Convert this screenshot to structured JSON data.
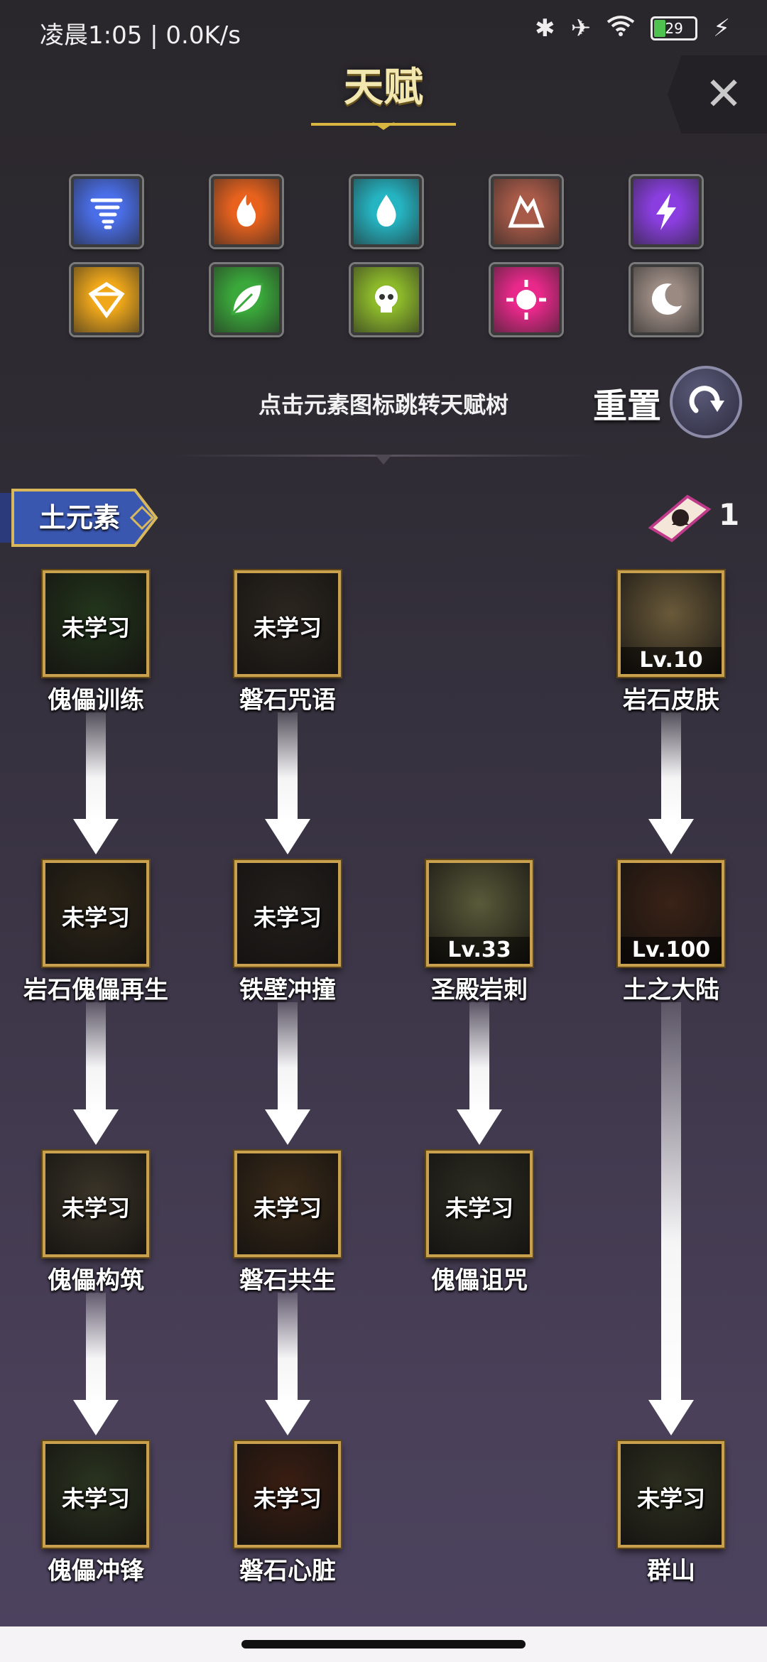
{
  "status_bar": {
    "time": "凌晨1:05 | 0.0K/s",
    "battery": "29"
  },
  "header": {
    "title": "天赋",
    "close_icon": "close-icon"
  },
  "elements": [
    {
      "name": "wind",
      "color": "#4a6ee8",
      "icon": "tornado-icon"
    },
    {
      "name": "fire",
      "color": "#e8621e",
      "icon": "flame-icon"
    },
    {
      "name": "water",
      "color": "#25b4c2",
      "icon": "drop-icon"
    },
    {
      "name": "earth",
      "color": "#a85a48",
      "icon": "rock-icon"
    },
    {
      "name": "lightning",
      "color": "#8a3ee0",
      "icon": "lightning-icon"
    },
    {
      "name": "light",
      "color": "#f0a81a",
      "icon": "gem-icon"
    },
    {
      "name": "nature",
      "color": "#3aa83a",
      "icon": "leaf-icon"
    },
    {
      "name": "poison",
      "color": "#8cb82a",
      "icon": "skull-icon"
    },
    {
      "name": "holy",
      "color": "#e8288a",
      "icon": "sun-icon"
    },
    {
      "name": "dark",
      "color": "#9a8a82",
      "icon": "moon-icon"
    }
  ],
  "hint": "点击元素图标跳转天赋树",
  "reset": {
    "label": "重置"
  },
  "section": {
    "title": "土元素",
    "points": "1"
  },
  "talents": [
    {
      "id": "golem-training",
      "name": "傀儡训练",
      "state": "未学习",
      "level": "",
      "col": 0,
      "row": 0,
      "bg": "#23361c"
    },
    {
      "id": "boulder-curse",
      "name": "磐石咒语",
      "state": "未学习",
      "level": "",
      "col": 1,
      "row": 0,
      "bg": "#2c2620"
    },
    {
      "id": "rock-skin",
      "name": "岩石皮肤",
      "state": "",
      "level": "Lv.10",
      "col": 3,
      "row": 0,
      "bg": "#6a5a3a"
    },
    {
      "id": "rock-golem-regen",
      "name": "岩石傀儡再生",
      "state": "未学习",
      "level": "",
      "col": 0,
      "row": 1,
      "bg": "#2e2618"
    },
    {
      "id": "iron-wall-charge",
      "name": "铁壁冲撞",
      "state": "未学习",
      "level": "",
      "col": 1,
      "row": 1,
      "bg": "#221f1c"
    },
    {
      "id": "shrine-rock-spike",
      "name": "圣殿岩刺",
      "state": "",
      "level": "Lv.33",
      "col": 2,
      "row": 1,
      "bg": "#5a5a3a"
    },
    {
      "id": "earth-continent",
      "name": "土之大陆",
      "state": "",
      "level": "Lv.100",
      "col": 3,
      "row": 1,
      "bg": "#3a2216"
    },
    {
      "id": "golem-construct",
      "name": "傀儡构筑",
      "state": "未学习",
      "level": "",
      "col": 0,
      "row": 2,
      "bg": "#3a3428"
    },
    {
      "id": "boulder-symbiosis",
      "name": "磐石共生",
      "state": "未学习",
      "level": "",
      "col": 1,
      "row": 2,
      "bg": "#3a2a18"
    },
    {
      "id": "golem-curse",
      "name": "傀儡诅咒",
      "state": "未学习",
      "level": "",
      "col": 2,
      "row": 2,
      "bg": "#2c2c22"
    },
    {
      "id": "golem-charge",
      "name": "傀儡冲锋",
      "state": "未学习",
      "level": "",
      "col": 0,
      "row": 3,
      "bg": "#2a3420"
    },
    {
      "id": "boulder-heart",
      "name": "磐石心脏",
      "state": "未学习",
      "level": "",
      "col": 1,
      "row": 3,
      "bg": "#3a1e12"
    },
    {
      "id": "mountains",
      "name": "群山",
      "state": "未学习",
      "level": "",
      "col": 3,
      "row": 3,
      "bg": "#2e3020"
    }
  ],
  "arrows": [
    {
      "col": 0,
      "from": 0,
      "to": 1
    },
    {
      "col": 1,
      "from": 0,
      "to": 1
    },
    {
      "col": 3,
      "from": 0,
      "to": 1
    },
    {
      "col": 0,
      "from": 1,
      "to": 2
    },
    {
      "col": 1,
      "from": 1,
      "to": 2
    },
    {
      "col": 2,
      "from": 1,
      "to": 2
    },
    {
      "col": 0,
      "from": 2,
      "to": 3
    },
    {
      "col": 1,
      "from": 2,
      "to": 3
    },
    {
      "col": 3,
      "from": 1,
      "to": 3
    }
  ]
}
